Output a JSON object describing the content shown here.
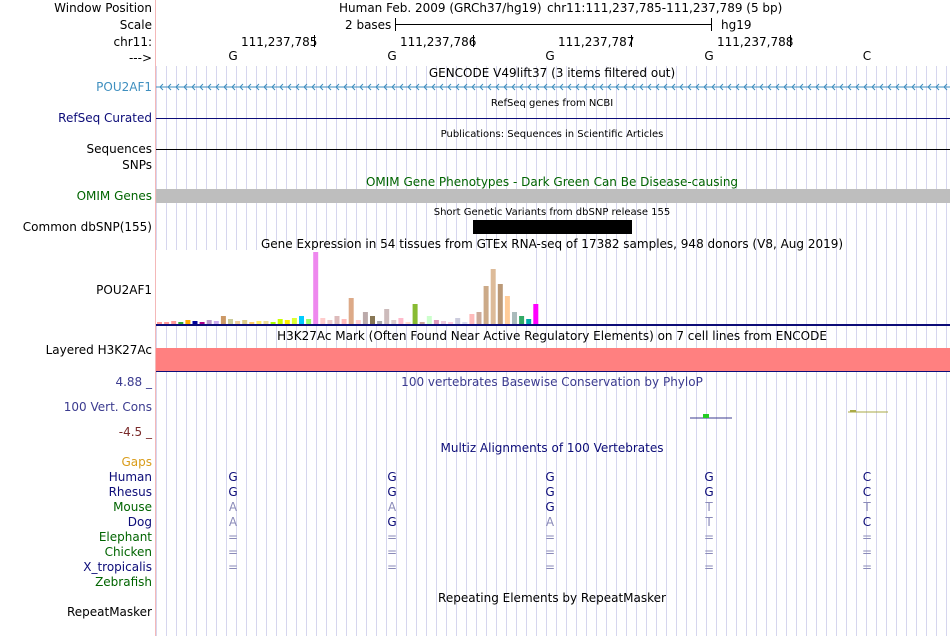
{
  "labels": {
    "window_position": "Window Position",
    "scale": "Scale",
    "chrom": "chr11:",
    "arrow": "--->",
    "gencode_gene": "POU2AF1",
    "refseq": "RefSeq Curated",
    "sequences": "Sequences",
    "snps": "SNPs",
    "omim": "OMIM Genes",
    "dbsnp": "Common dbSNP(155)",
    "gtex_gene": "POU2AF1",
    "h3k27ac": "Layered H3K27Ac",
    "cons_max": "4.88 _",
    "cons": "100 Vert. Cons",
    "cons_min": "-4.5 _",
    "gaps": "Gaps",
    "species": [
      "Human",
      "Rhesus",
      "Mouse",
      "Dog",
      "Elephant",
      "Chicken",
      "X_tropicalis",
      "Zebrafish"
    ],
    "repeatmasker": "RepeatMasker"
  },
  "header": {
    "assembly": "Human Feb. 2009 (GRCh37/hg19)",
    "position": "chr11:111,237,785-111,237,789 (5 bp)",
    "scale_text": "2 bases",
    "scale_db": "hg19",
    "ruler": [
      "111,237,785",
      "111,237,786",
      "111,237,787",
      "111,237,788"
    ],
    "bases": [
      "G",
      "G",
      "G",
      "G",
      "C"
    ]
  },
  "titles": {
    "gencode": "GENCODE V49lift37 (3 items filtered out)",
    "refseq": "RefSeq genes from NCBI",
    "publications": "Publications: Sequences in Scientific Articles",
    "omim": "OMIM Gene Phenotypes - Dark Green Can Be Disease-causing",
    "dbsnp": "Short Genetic Variants from dbSNP release 155",
    "gtex": "Gene Expression in 54 tissues from GTEx RNA-seq of 17382 samples, 948 donors (V8, Aug 2019)",
    "h3k27ac": "H3K27Ac Mark (Often Found Near Active Regulatory Elements) on 7 cell lines from ENCODE",
    "phylop": "100 vertebrates Basewise Conservation by PhyloP",
    "multiz": "Multiz Alignments of 100 Vertebrates",
    "repeatmasker": "Repeating Elements by RepeatMasker"
  },
  "alignment": [
    [
      "G",
      "G",
      "G",
      "G",
      "C"
    ],
    [
      "G",
      "G",
      "G",
      "G",
      "C"
    ],
    [
      "A",
      "A",
      "G",
      "T",
      "T"
    ],
    [
      "A",
      "G",
      "A",
      "T",
      "C"
    ],
    [
      "=",
      "=",
      "=",
      "=",
      "="
    ],
    [
      "=",
      "=",
      "=",
      "=",
      "="
    ],
    [
      "=",
      "=",
      "=",
      "=",
      "="
    ]
  ],
  "gtex_values": [
    2,
    2,
    3,
    2,
    4,
    3,
    2,
    4,
    3,
    8,
    5,
    3,
    4,
    2,
    3,
    3,
    2,
    5,
    4,
    6,
    8,
    5,
    72,
    6,
    4,
    8,
    5,
    26,
    4,
    12,
    8,
    3,
    15,
    4,
    6,
    2,
    20,
    2,
    8,
    4,
    3,
    2,
    6,
    2,
    10,
    12,
    38,
    55,
    40,
    28,
    12,
    8,
    5,
    20
  ],
  "gtex_colors": [
    "#ff9999",
    "#ff9999",
    "#ff9999",
    "#33aa33",
    "#ffaa00",
    "#000099",
    "#aa0088",
    "#bb99cc",
    "#ccaaee",
    "#cc9966",
    "#cccc99",
    "#eecc99",
    "#ddcc88",
    "#ffcc66",
    "#ffee66",
    "#eedd99",
    "#aaff00",
    "#ccff00",
    "#ffee00",
    "#ddff33",
    "#00ccff",
    "#99ff66",
    "#ee88ee",
    "#ffcccc",
    "#eecccc",
    "#ddbbbb",
    "#ffbbbb",
    "#ddaa88",
    "#ffcccc",
    "#bbaaaa",
    "#887755",
    "#aaaaaa",
    "#ccbbbb",
    "#ddcccc",
    "#ffbbcc",
    "#ffddcc",
    "#88bb33",
    "#ccaa99",
    "#ccffcc",
    "#dd99bb",
    "#eeccdd",
    "#ffccdd",
    "#ccccdd",
    "#ddddee",
    "#ffbbbb",
    "#ccaa99",
    "#ccaa88",
    "#ddbb99",
    "#bb9977",
    "#ffcc99",
    "#aabbbb",
    "#33aa66",
    "#00aaaa",
    "#ff00ff"
  ],
  "colors": {
    "gencode": "#3f8fbf",
    "refseq": "#0c0c78",
    "omim": "#006400",
    "omim_bar": "#bebebe",
    "h3k27ac": "#ff8080",
    "cons_label": "#3b3b8f",
    "cons_min": "#7a2b2b",
    "gaps": "#d99c1a",
    "grid": "#d6d6ee"
  }
}
